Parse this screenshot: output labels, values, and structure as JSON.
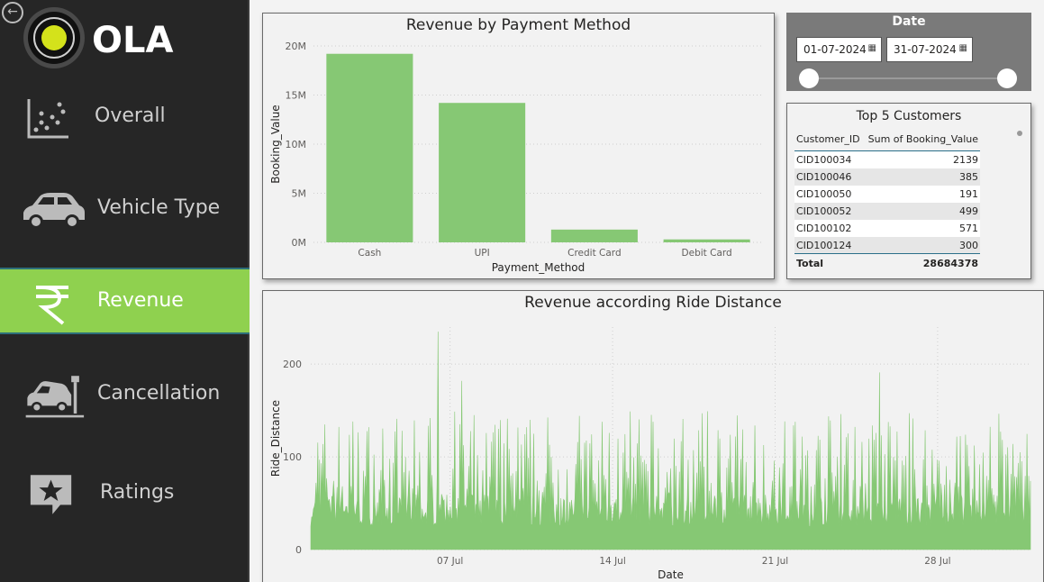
{
  "sidebar": {
    "logo_text": "OLA",
    "items": [
      {
        "label": "Overall",
        "icon": "scatter-chart-icon",
        "active": false
      },
      {
        "label": "Vehicle Type",
        "icon": "car-icon",
        "active": false
      },
      {
        "label": "Revenue",
        "icon": "rupee-icon",
        "active": true
      },
      {
        "label": "Cancellation",
        "icon": "car-crash-icon",
        "active": false
      },
      {
        "label": "Ratings",
        "icon": "star-comment-icon",
        "active": false
      }
    ]
  },
  "colors": {
    "accent": "#8fd14f",
    "bar": "#86c874",
    "sidebar_bg": "#262626",
    "slicer_bg": "#7a7a7a"
  },
  "date_slicer": {
    "title": "Date",
    "start": "01-07-2024",
    "end": "31-07-2024"
  },
  "top_customers": {
    "title": "Top 5 Customers",
    "columns": [
      "Customer_ID",
      "Sum of Booking_Value"
    ],
    "rows": [
      [
        "CID100034",
        "2139"
      ],
      [
        "CID100046",
        "385"
      ],
      [
        "CID100050",
        "191"
      ],
      [
        "CID100052",
        "499"
      ],
      [
        "CID100102",
        "571"
      ],
      [
        "CID100124",
        "300"
      ]
    ],
    "total_label": "Total",
    "total_value": "28684378"
  },
  "chart_data": [
    {
      "type": "bar",
      "title": "Revenue by Payment Method",
      "xlabel": "Payment_Method",
      "ylabel": "Booking_Value",
      "categories": [
        "Cash",
        "UPI",
        "Credit Card",
        "Debit Card"
      ],
      "values": [
        19200000,
        14200000,
        1300000,
        300000
      ],
      "ylim": [
        0,
        20000000
      ],
      "yticks": [
        0,
        5000000,
        10000000,
        15000000,
        20000000
      ],
      "ytick_labels": [
        "0M",
        "5M",
        "10M",
        "15M",
        "20M"
      ],
      "grid": true
    },
    {
      "type": "area",
      "title": "Revenue according Ride Distance",
      "xlabel": "Date",
      "ylabel": "Ride_Distance",
      "x_range": [
        "2024-07-01",
        "2024-07-31"
      ],
      "xticks": [
        "07 Jul",
        "14 Jul",
        "21 Jul",
        "28 Jul"
      ],
      "ylim": [
        0,
        240
      ],
      "yticks": [
        0,
        100,
        200
      ],
      "typical_range": [
        25,
        150
      ],
      "peaks": [
        {
          "date": "2024-07-06",
          "value": 235
        },
        {
          "date": "2024-07-07",
          "value": 182
        },
        {
          "date": "2024-07-25",
          "value": 191
        }
      ],
      "grid": true
    }
  ]
}
